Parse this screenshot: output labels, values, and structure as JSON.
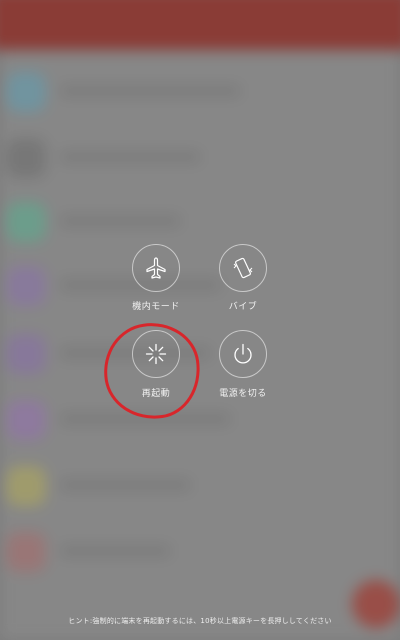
{
  "power_menu": {
    "airplane_mode_label": "機内モード",
    "vibrate_label": "バイブ",
    "restart_label": "再起動",
    "power_off_label": "電源を切る"
  },
  "hint_text": "ヒント:強制的に端末を再起動するには、10秒以上電源キーを長押ししてください",
  "colors": {
    "annotation_circle": "#d8262b",
    "background_header": "#8e2f28",
    "icon_stroke": "#ffffff"
  },
  "icons": {
    "airplane_mode": "airplane-icon",
    "vibrate": "vibrate-phone-icon",
    "restart": "restart-spinner-icon",
    "power_off": "power-icon"
  }
}
